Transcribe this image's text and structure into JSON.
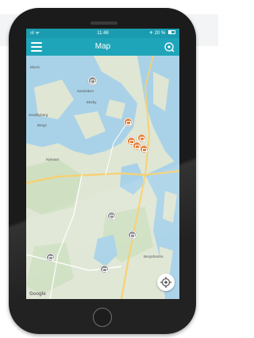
{
  "status_bar": {
    "signal": "ııl ᯤ",
    "time": "11:48",
    "battery_text": "✈ 20 %",
    "battery_level_percent": 20
  },
  "app_bar": {
    "title": "Map",
    "menu_icon": "hamburger-menu-icon",
    "right_icon": "search-location-icon"
  },
  "map": {
    "place_labels": [
      "Ekerö",
      "Sandviken",
      "Ekeby",
      "Sundbyberg",
      "Bergs",
      "Nykvarn",
      "Bergshamra"
    ],
    "attribution": "Google",
    "locate_icon": "my-location-icon",
    "marker_colors": {
      "active": "#e3823a",
      "inactive": "#8c8c8c"
    }
  },
  "colors": {
    "app_bar": "#1fa5b9",
    "status_bar": "#1a9bb0",
    "water": "#a9d2e8",
    "land": "#dfe6d4"
  }
}
